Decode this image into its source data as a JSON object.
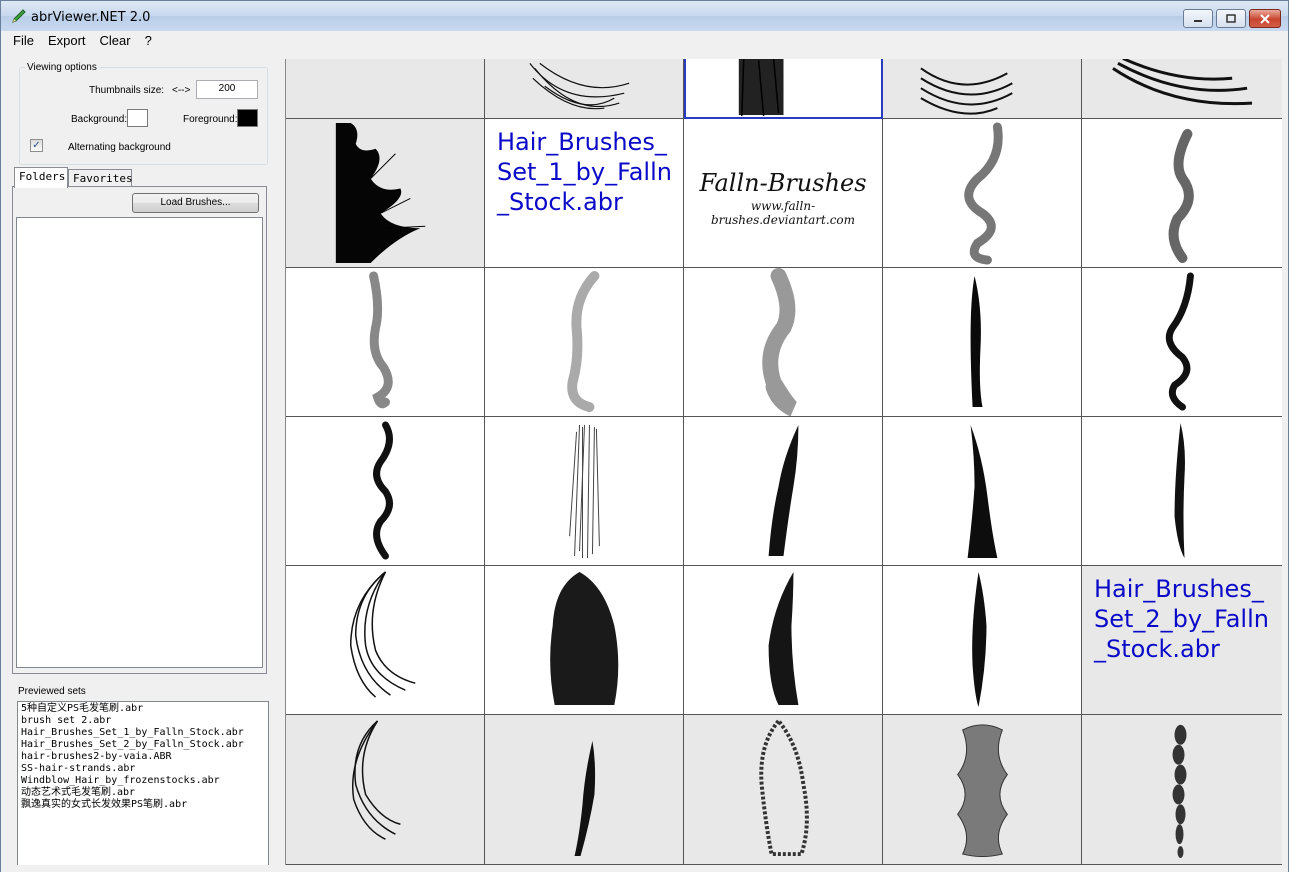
{
  "window": {
    "title": "abrViewer.NET 2.0"
  },
  "menu": {
    "items": [
      "File",
      "Export",
      "Clear",
      "?"
    ]
  },
  "viewing_options": {
    "title": "Viewing options",
    "thumb_label": "Thumbnails size:",
    "arrows": "<-->",
    "thumb_value": "200",
    "background_label": "Background:",
    "background_color": "#ffffff",
    "foreground_label": "Foreground:",
    "foreground_color": "#000000",
    "alt_bg_label": "Alternating background",
    "alt_bg_checked": true
  },
  "tabs": {
    "folders": "Folders",
    "favorites": "Favorites"
  },
  "load_button": "Load Brushes...",
  "previewed": {
    "label": "Previewed sets",
    "items": [
      "5种自定义PS毛发笔刷.abr",
      "brush set 2.abr",
      "Hair_Brushes_Set_1_by_Falln_Stock.abr",
      "Hair_Brushes_Set_2_by_Falln_Stock.abr",
      "hair-brushes2-by-vaia.ABR",
      "SS-hair-strands.abr",
      "Windblow_Hair_by_frozenstocks.abr",
      "动态艺术式毛发笔刷.abr",
      "飘逸真实的女式长发效果PS笔刷.abr"
    ]
  },
  "grid": {
    "set1_name": "Hair_Brushes_Set_1_by_Falln_Stock.abr",
    "set2_name": "Hair_Brushes_Set_2_by_Falln_Stock.abr",
    "signature_title": "Falln-Brushes",
    "signature_url": "www.falln-brushes.deviantart.com",
    "selection_color": "#2a3cc0",
    "set_name_color": "#0a0ac8"
  },
  "icons": {
    "app": "pencil-brush-icon",
    "minimize": "minimize-icon",
    "maximize": "maximize-icon",
    "close": "close-icon",
    "check": "checkmark-icon"
  }
}
